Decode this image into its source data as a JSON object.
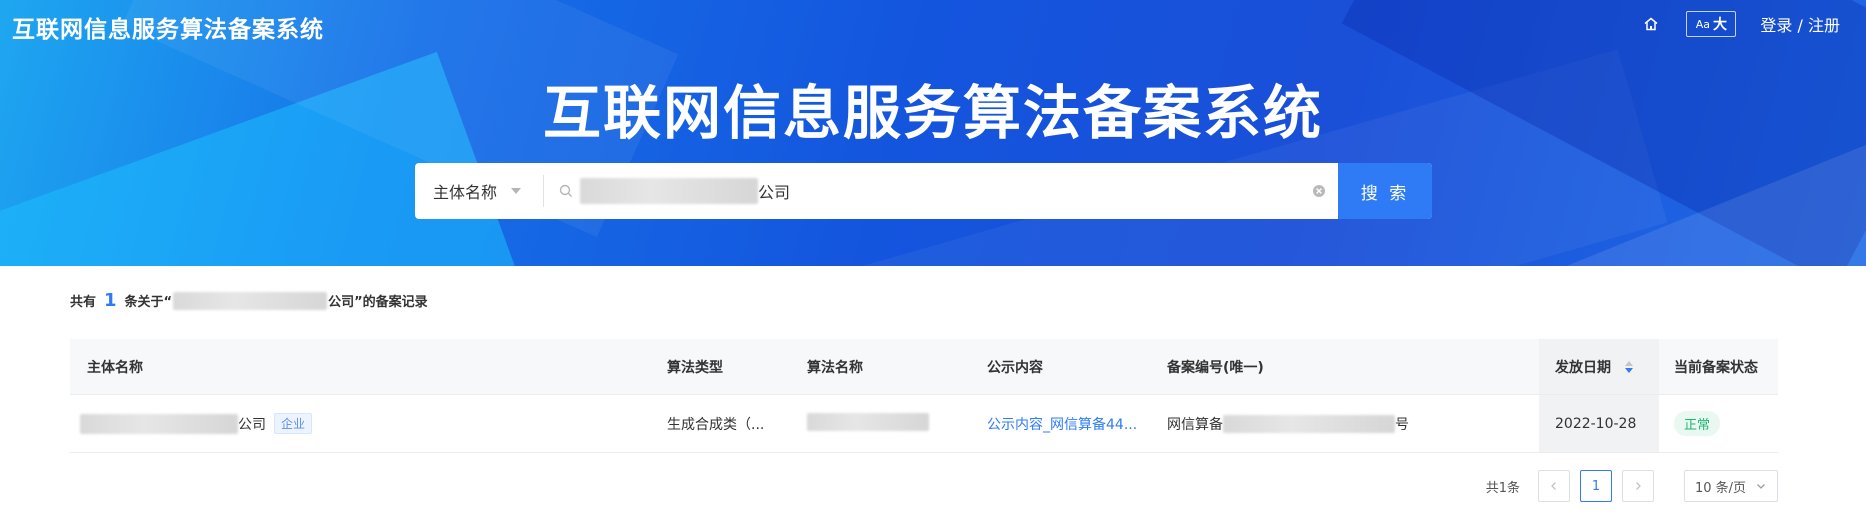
{
  "header": {
    "site_title": "互联网信息服务算法备案系统",
    "font_toggle_small": "Aa",
    "font_toggle_big": "大",
    "login_label": "登录 / 注册"
  },
  "hero": {
    "title": "互联网信息服务算法备案系统"
  },
  "search": {
    "type_label": "主体名称",
    "query_suffix": "公司",
    "button_label": "搜 索"
  },
  "summary": {
    "prefix": "共有",
    "count": "1",
    "middle": "条关于“",
    "suffix": "公司”的备案记录"
  },
  "table": {
    "columns": [
      "主体名称",
      "算法类型",
      "算法名称",
      "公示内容",
      "备案编号(唯一)",
      "发放日期",
      "当前备案状态"
    ],
    "rows": [
      {
        "entity_suffix": "公司",
        "entity_tag": "企业",
        "algo_type": "生成合成类（...",
        "public_content": "公示内容_网信算备44...",
        "record_prefix": "网信算备",
        "record_suffix": "号",
        "issue_date": "2022-10-28",
        "status": "正常"
      }
    ]
  },
  "pagination": {
    "total_label": "共1条",
    "current_page": "1",
    "page_size_label": "10 条/页"
  },
  "colors": {
    "accent": "#2f7bf5",
    "status_ok": "#22b573"
  },
  "icons": {
    "home": "home-icon",
    "search": "search-icon",
    "clear": "clear-icon",
    "sort": "sort-caret-icon"
  }
}
